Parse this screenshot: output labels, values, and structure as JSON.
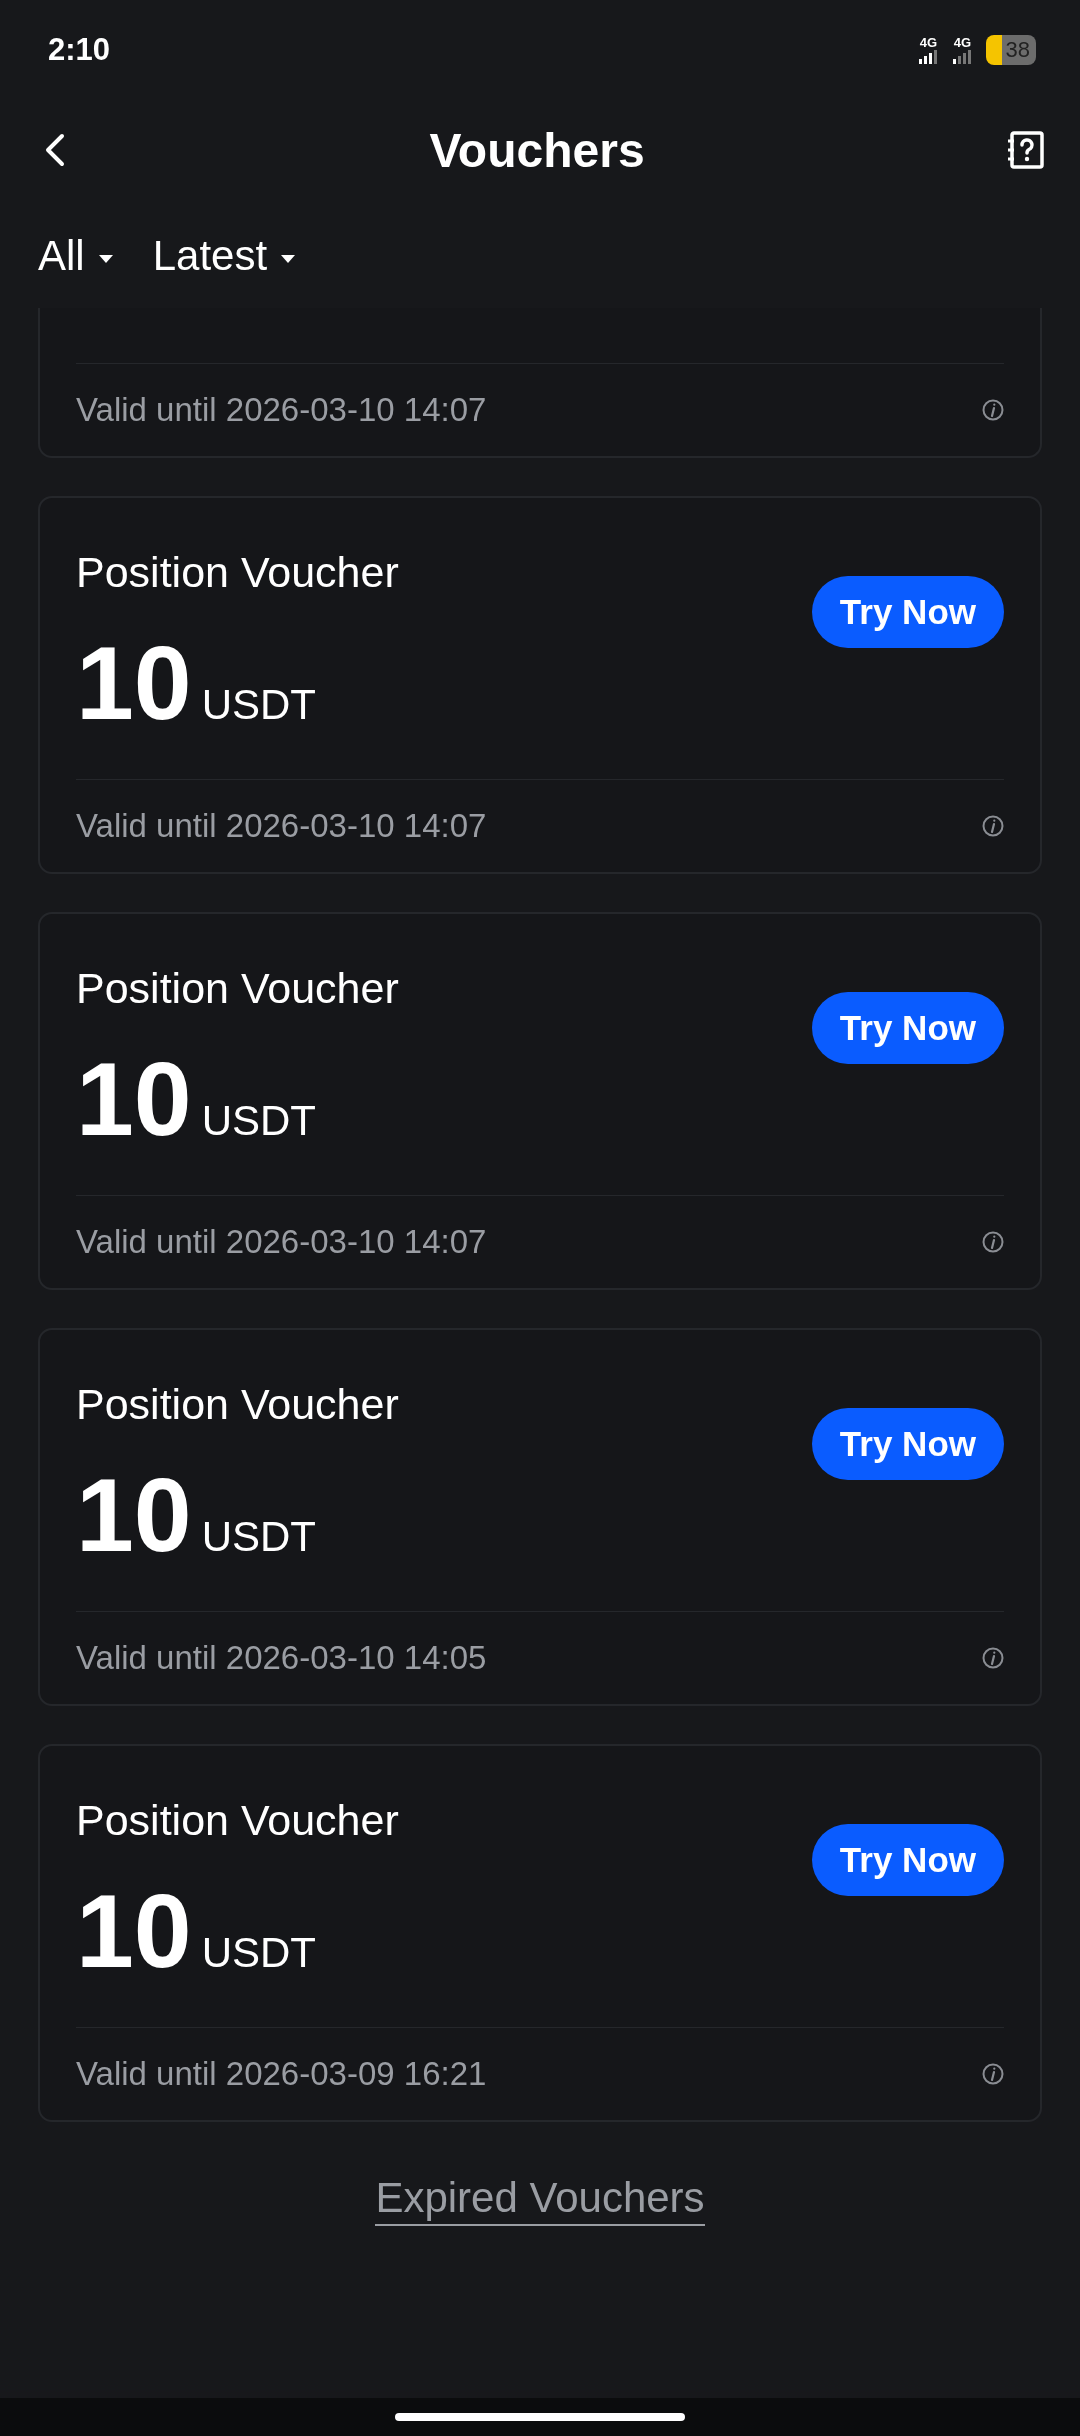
{
  "status_bar": {
    "time": "2:10",
    "network_1": "4G",
    "network_2": "4G",
    "battery": "38"
  },
  "header": {
    "title": "Vouchers"
  },
  "filters": [
    {
      "label": "All"
    },
    {
      "label": "Latest"
    }
  ],
  "vouchers": [
    {
      "kind": "partial",
      "valid": "Valid until 2026-03-10 14:07"
    },
    {
      "kind": "full",
      "title": "Position Voucher",
      "amount": "10",
      "unit": "USDT",
      "button": "Try Now",
      "valid": "Valid until 2026-03-10 14:07"
    },
    {
      "kind": "full",
      "title": "Position Voucher",
      "amount": "10",
      "unit": "USDT",
      "button": "Try Now",
      "valid": "Valid until 2026-03-10 14:07"
    },
    {
      "kind": "full",
      "title": "Position Voucher",
      "amount": "10",
      "unit": "USDT",
      "button": "Try Now",
      "valid": "Valid until 2026-03-10 14:05"
    },
    {
      "kind": "full",
      "title": "Position Voucher",
      "amount": "10",
      "unit": "USDT",
      "button": "Try Now",
      "valid": "Valid until 2026-03-09 16:21"
    }
  ],
  "footer_link": "Expired Vouchers"
}
